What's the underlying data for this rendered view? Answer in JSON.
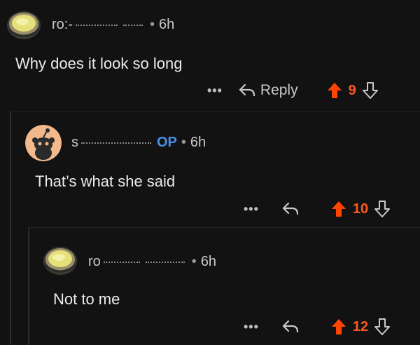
{
  "comments": [
    {
      "username": "ro:-",
      "age": "6h",
      "text": "Why does it look so long",
      "reply_label": "Reply",
      "more_label": "•••",
      "score": "9"
    },
    {
      "username": "s",
      "op_badge": "OP",
      "age": "6h",
      "text": "That’s what she said",
      "more_label": "•••",
      "score": "10"
    },
    {
      "username": "ro",
      "age": "6h",
      "text": "Not to me",
      "more_label": "•••",
      "score": "12"
    }
  ],
  "colors": {
    "background": "#121212",
    "upvote": "#ff4500",
    "score": "#ff5a1f",
    "op": "#4a90e2",
    "text": "#ececec"
  },
  "icons": {
    "avatar_teacup": "teacup-avatar-icon",
    "avatar_snoo": "snoo-avatar-icon",
    "reply": "reply-arrow-icon",
    "upvote": "upvote-arrow-icon",
    "downvote": "downvote-arrow-icon",
    "more": "more-options-icon"
  }
}
